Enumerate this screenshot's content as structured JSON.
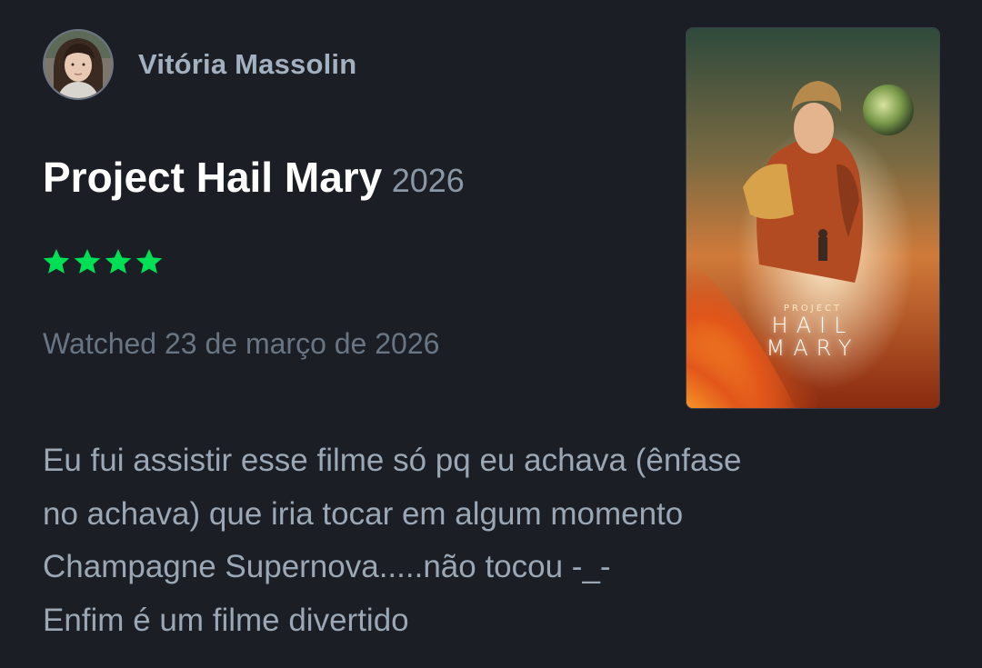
{
  "review": {
    "author": {
      "name": "Vitória Massolin",
      "avatar_icon": "user-avatar-photo"
    },
    "film": {
      "title": "Project Hail Mary",
      "year": "2026",
      "poster": {
        "kicker": "PROJECT",
        "line1": "HAIL",
        "line2": "MARY"
      }
    },
    "rating": {
      "stars": 4,
      "max": 5,
      "star_color": "#00e054",
      "icon": "star-icon"
    },
    "watched": "Watched 23 de março de 2026",
    "body": [
      "Eu fui assistir esse filme só pq eu achava (ênfase",
      "no achava) que iria tocar em algum momento",
      "Champagne Supernova.....não tocou -_-",
      "Enfim é um filme divertido"
    ]
  },
  "colors": {
    "background": "#1b1e24",
    "title": "#ffffff",
    "muted": "#6a7583",
    "text": "#9ba7b4",
    "accent_green": "#00e054"
  }
}
